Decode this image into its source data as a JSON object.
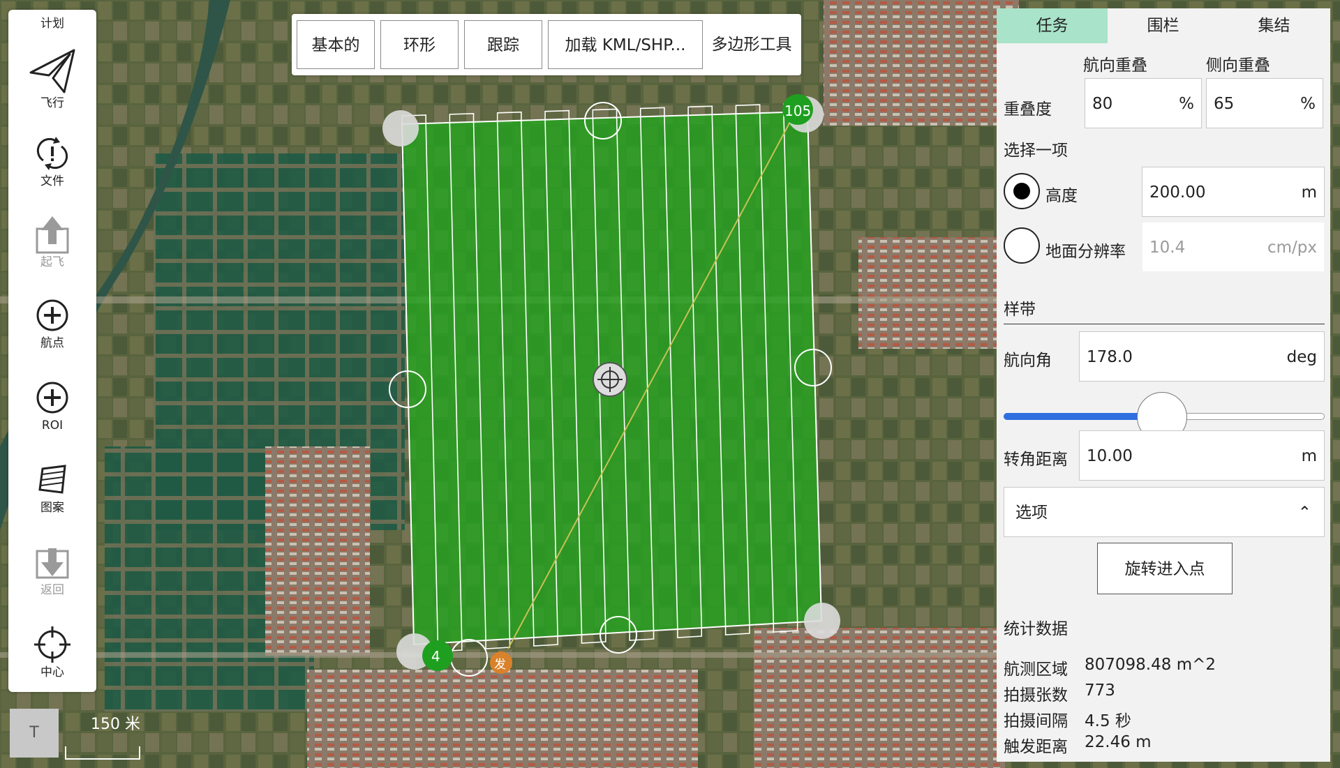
{
  "toolbar": {
    "plan_label": "计划",
    "items": [
      {
        "label": "飞行",
        "icon": "paper-plane-icon",
        "enabled": true
      },
      {
        "label": "文件",
        "icon": "sync-alert-icon",
        "enabled": true
      },
      {
        "label": "起飞",
        "icon": "takeoff-icon",
        "enabled": false
      },
      {
        "label": "航点",
        "icon": "plus-circle-icon",
        "enabled": true
      },
      {
        "label": "ROI",
        "icon": "plus-circle-icon",
        "enabled": true
      },
      {
        "label": "图案",
        "icon": "pattern-icon",
        "enabled": true
      },
      {
        "label": "返回",
        "icon": "return-icon",
        "enabled": false
      },
      {
        "label": "中心",
        "icon": "crosshair-icon",
        "enabled": true
      }
    ]
  },
  "patterns": {
    "basic": "基本的",
    "circular": "环形",
    "track": "跟踪",
    "load_kml": "加载 KML/SHP...",
    "polygon_tool": "多边形工具"
  },
  "map": {
    "waypoint_start": "4",
    "waypoint_end": "105",
    "launch_label": "发",
    "scale_label": "150 米",
    "terrain_button": "T",
    "colors": {
      "survey_fill": "#22a51e",
      "waypoint_green": "#1f9f1f",
      "launch_orange": "#d9822b"
    }
  },
  "panel": {
    "tabs": [
      "任务",
      "围栏",
      "集结"
    ],
    "active_tab": 0,
    "overlap": {
      "front_label": "航向重叠",
      "side_label": "侧向重叠",
      "row_label": "重叠度",
      "front_value": "80",
      "side_value": "65",
      "unit": "%"
    },
    "select_one": "选择一项",
    "altitude": {
      "label": "高度",
      "value": "200.00",
      "unit": "m",
      "selected": true
    },
    "gsd": {
      "label": "地面分辨率",
      "value": "10.4",
      "unit": "cm/px",
      "selected": false
    },
    "swath_title": "样带",
    "heading": {
      "label": "航向角",
      "value": "178.0",
      "unit": "deg",
      "slider_fraction": 0.494
    },
    "turnaround": {
      "label": "转角距离",
      "value": "10.00",
      "unit": "m"
    },
    "options_label": "选项",
    "rotate_button": "旋转进入点",
    "stats": {
      "title": "统计数据",
      "rows": [
        {
          "label": "航测区域",
          "value": "807098.48 m^2"
        },
        {
          "label": "拍摄张数",
          "value": "773"
        },
        {
          "label": "拍摄间隔",
          "value": "4.5 秒"
        },
        {
          "label": "触发距离",
          "value": "22.46 m"
        }
      ]
    },
    "accent_color": "#a9e3c9",
    "slider_color": "#2f6fe0"
  }
}
